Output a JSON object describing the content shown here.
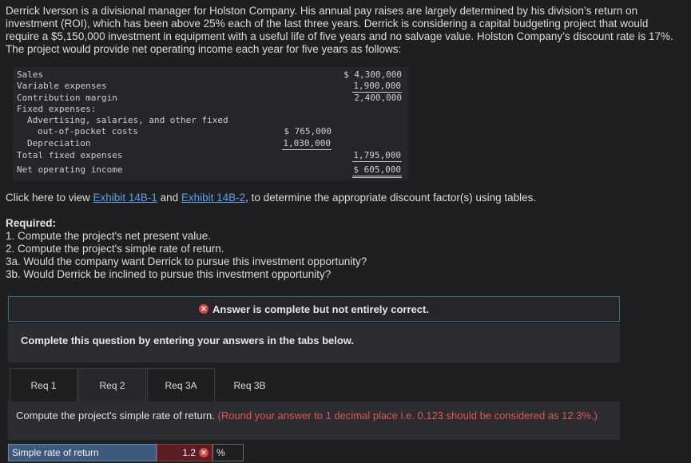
{
  "intro": "Derrick Iverson is a divisional manager for Holston Company. His annual pay raises are largely determined by his division’s return on investment (ROI), which has been above 25% each of the last three years. Derrick is considering a capital budgeting project that would require a $5,150,000 investment in equipment with a useful life of five years and no salvage value. Holston Company’s discount rate is 17%. The project would provide net operating income each year for five years as follows:",
  "statement": {
    "sales": {
      "label": "Sales",
      "value": "$ 4,300,000"
    },
    "variable": {
      "label": "Variable expenses",
      "value": "1,900,000"
    },
    "contribution": {
      "label": "Contribution margin",
      "value": "2,400,000"
    },
    "fixed_header": "Fixed expenses:",
    "advertising_1": "Advertising, salaries, and other fixed",
    "advertising_2": "out-of-pocket costs",
    "advertising_value": "$ 765,000",
    "depreciation": {
      "label": "Depreciation",
      "value": "1,030,000"
    },
    "total_fixed": {
      "label": "Total fixed expenses",
      "value": "1,795,000"
    },
    "noi": {
      "label": "Net operating income",
      "value": "$ 605,000"
    }
  },
  "links": {
    "prefix": "Click here to view ",
    "exhibit1": "Exhibit 14B-1",
    "mid": " and ",
    "exhibit2": "Exhibit 14B-2",
    "suffix": ", to determine the appropriate discount factor(s) using tables."
  },
  "required": {
    "title": "Required:",
    "items": [
      "1. Compute the project's net present value.",
      "2. Compute the project's simple rate of return.",
      "3a. Would the company want Derrick to pursue this investment opportunity?",
      "3b. Would Derrick be inclined to pursue this investment opportunity?"
    ]
  },
  "banner": {
    "icon": "x-circle-icon",
    "text": "Answer is complete but not entirely correct."
  },
  "instruction": "Complete this question by entering your answers in the tabs below.",
  "tabs": [
    {
      "label": "Req 1"
    },
    {
      "label": "Req 2"
    },
    {
      "label": "Req 3A"
    },
    {
      "label": "Req 3B"
    }
  ],
  "task": {
    "text": "Compute the project's simple rate of return. ",
    "note": "(Round your answer to 1 decimal place i.e. 0.123 should be considered as 12.3%.)"
  },
  "answer": {
    "label": "Simple rate of return",
    "value": "1.2",
    "status": "incorrect",
    "unit": "%"
  },
  "colors": {
    "link": "#5ea0e8",
    "error": "#e04040",
    "accent_border": "#3a6a86"
  }
}
